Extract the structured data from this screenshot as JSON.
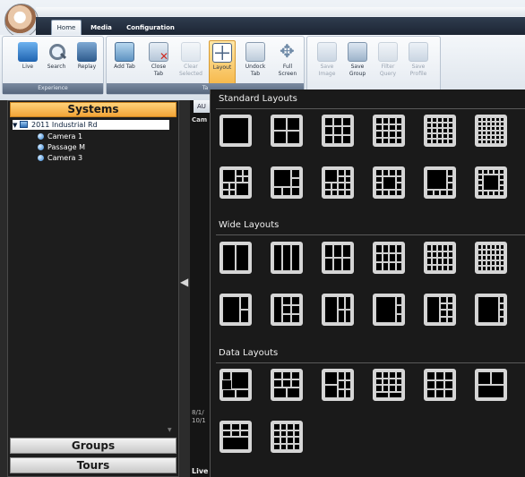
{
  "ribbon": {
    "tabs": [
      "Home",
      "Media",
      "Configuration"
    ],
    "groups": {
      "experience": {
        "label": "Experience",
        "buttons": [
          {
            "label": "Live",
            "icon": "live-icon"
          },
          {
            "label": "Search",
            "icon": "search-icon"
          },
          {
            "label": "Replay",
            "icon": "replay-icon"
          }
        ]
      },
      "tabs": {
        "label": "Ta",
        "buttons": [
          {
            "label": "Add Tab",
            "icon": "add-tab-icon"
          },
          {
            "label": "Close\nTab",
            "icon": "close-tab-icon"
          },
          {
            "label": "Clear\nSelected",
            "icon": "clear-selected-icon",
            "disabled": true
          },
          {
            "label": "Layout",
            "icon": "layout-icon",
            "selected": true
          },
          {
            "label": "Undock\nTab",
            "icon": "undock-tab-icon"
          },
          {
            "label": "Full\nScreen",
            "icon": "full-screen-icon"
          }
        ]
      },
      "misc": {
        "buttons": [
          {
            "label": "Save\nImage",
            "icon": "save-image-icon",
            "disabled": true
          },
          {
            "label": "Save\nGroup",
            "icon": "save-group-icon"
          },
          {
            "label": "Filter\nQuery",
            "icon": "filter-query-icon",
            "disabled": true
          },
          {
            "label": "Save\nProfile",
            "icon": "save-profile-icon",
            "disabled": true
          }
        ]
      }
    }
  },
  "systems_panel": {
    "header": "Systems",
    "tree": {
      "site": "2011 Industrial Rd",
      "cameras": [
        "Camera 1",
        "Passage M",
        "Camera 3"
      ]
    },
    "groups_label": "Groups",
    "tours_label": "Tours"
  },
  "video": {
    "tab_label": "AU",
    "camera_label": "Cam",
    "live_label": "Live",
    "vertical_text": "8/1/ 10/1"
  },
  "layout_popup": {
    "sections": [
      "Standard Layouts",
      "Wide Layouts",
      "Data Layouts"
    ]
  },
  "colors": {
    "accent": "#f2a437",
    "panel_bg": "#1d1d1d",
    "popup_bg": "#1a1a1a",
    "tile_border": "#d6d6d6"
  }
}
